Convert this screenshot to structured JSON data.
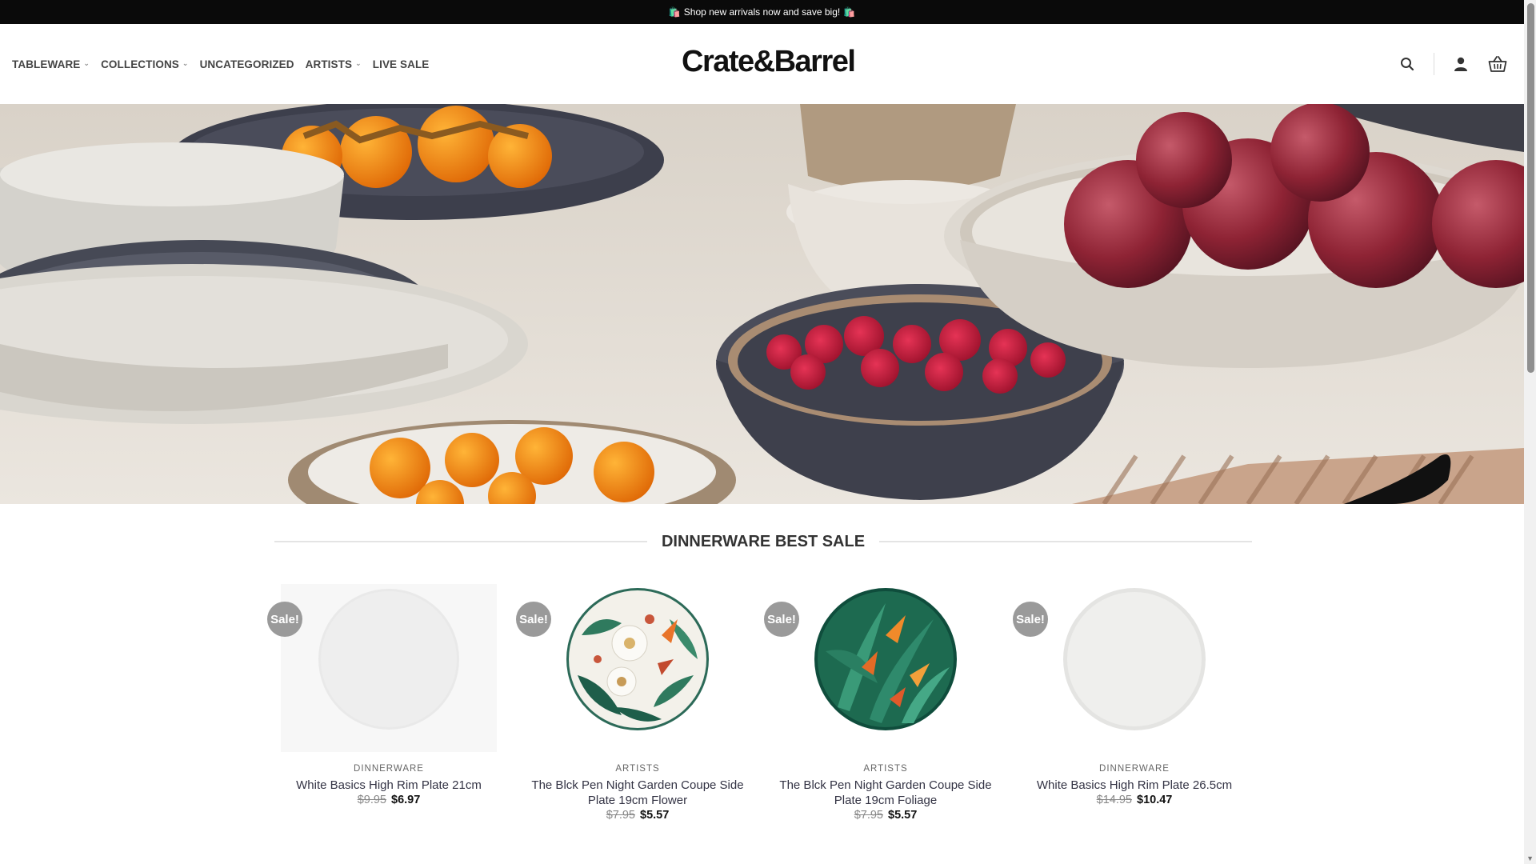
{
  "announcement": {
    "bag_left": "🛍️",
    "text": "Shop new arrivals now and save big!",
    "bag_right": "🛍️"
  },
  "nav": [
    {
      "label": "TABLEWARE",
      "has_dropdown": true
    },
    {
      "label": "COLLECTIONS",
      "has_dropdown": true
    },
    {
      "label": "UNCATEGORIZED",
      "has_dropdown": false
    },
    {
      "label": "ARTISTS",
      "has_dropdown": true
    },
    {
      "label": "LIVE SALE",
      "has_dropdown": false
    }
  ],
  "logo": "Crate&Barrel",
  "header_icons": [
    "search-icon",
    "user-icon",
    "basket-icon"
  ],
  "hero": {
    "description_icon": "hero-banner-dinnerware"
  },
  "section_title": "DINNERWARE BEST SALE",
  "products": [
    {
      "badge": "Sale!",
      "category": "DINNERWARE",
      "name": "White Basics High Rim Plate 21cm",
      "old_price": "$9.95",
      "price": "$6.97",
      "style": "white"
    },
    {
      "badge": "Sale!",
      "category": "ARTISTS",
      "name": "The Blck Pen Night Garden Coupe Side Plate 19cm Flower",
      "old_price": "$7.95",
      "price": "$5.57",
      "style": "flower"
    },
    {
      "badge": "Sale!",
      "category": "ARTISTS",
      "name": "The Blck Pen Night Garden Coupe Side Plate 19cm Foliage",
      "old_price": "$7.95",
      "price": "$5.57",
      "style": "foliage"
    },
    {
      "badge": "Sale!",
      "category": "DINNERWARE",
      "name": "White Basics High Rim Plate 26.5cm",
      "old_price": "$14.95",
      "price": "$10.47",
      "style": "white"
    }
  ],
  "colors": {
    "topbar": "#0a0a0a",
    "sale_badge": "#9a9a9a",
    "text_dark": "#333333"
  }
}
